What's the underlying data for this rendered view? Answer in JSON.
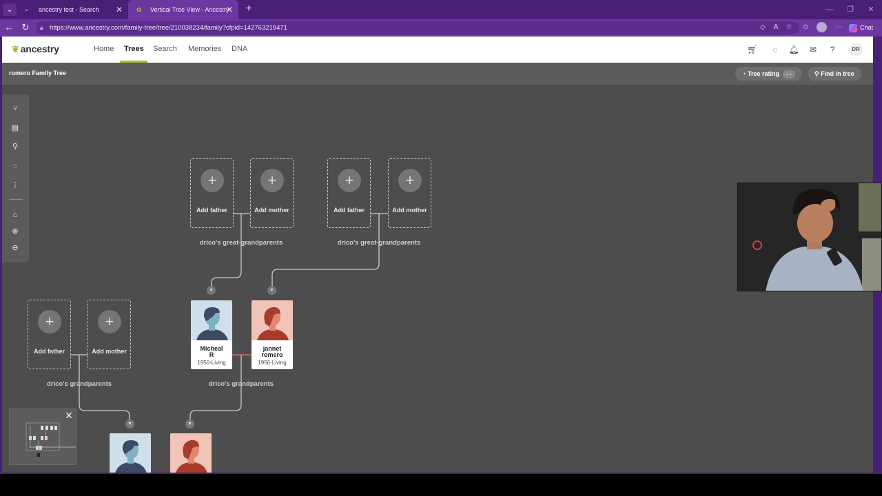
{
  "browser": {
    "tabs": [
      {
        "title": "ancestry test - Search",
        "active": false
      },
      {
        "title": "Vertical Tree View - Ancestry",
        "active": true
      }
    ],
    "url": "https://www.ancestry.com/family-tree/tree/210038234/family?cfpid=142763219471",
    "chat_label": "Chat"
  },
  "nav": {
    "logo": "ancestry",
    "links": [
      "Home",
      "Trees",
      "Search",
      "Memories",
      "DNA"
    ],
    "active": "Trees",
    "user_initials": "DR"
  },
  "subbar": {
    "tree_name": "romero Family Tree",
    "tree_rating_label": "Tree rating",
    "tree_rating_value": "- -",
    "find_label": "Find in tree"
  },
  "tree": {
    "add_father": "Add father",
    "add_mother": "Add mother",
    "group_labels": {
      "great1": "drico's great-grandparents",
      "great2": "drico's great-grandparents",
      "grand1": "drico's grandparents",
      "grand2": "drico's grandparents"
    },
    "people": [
      {
        "first": "Micheal",
        "last": "R",
        "dates": "1950-Living",
        "gender": "male"
      },
      {
        "first": "jannet",
        "last": "romero",
        "dates": "1956-Living",
        "gender": "female"
      }
    ]
  },
  "colors": {
    "brand_purple": "#4a1f78",
    "ancestry_green": "#9cbe30",
    "canvas": "#4d4d4d",
    "male_bg": "#cfe0ea",
    "female_bg": "#f2c4b8"
  }
}
